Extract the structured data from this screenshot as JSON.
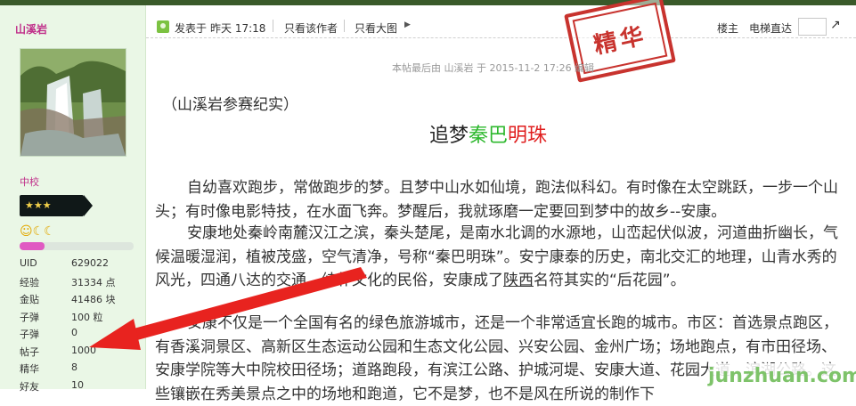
{
  "author": {
    "username": "山溪岩",
    "rank_title": "中校",
    "rank_stars": "★★★",
    "credit_progress": 0.22,
    "stats": [
      {
        "label": "UID",
        "value": "629022"
      },
      {
        "label": "经验",
        "value": "31334 点"
      },
      {
        "label": "金贴",
        "value": "41486 块"
      },
      {
        "label": "子弹",
        "value": "100 粒"
      },
      {
        "label": "子弹",
        "value": "0"
      },
      {
        "label": "帖子",
        "value": "1000"
      },
      {
        "label": "精华",
        "value": "8"
      },
      {
        "label": "好友",
        "value": "10"
      }
    ]
  },
  "post_header": {
    "posted_prefix": "发表于",
    "posted_time": "昨天 17:18",
    "only_author": "只看该作者",
    "view_large": "只看大图",
    "floor": "楼主",
    "elevator": "电梯直达"
  },
  "stamp_text": "精华",
  "last_edit": "本帖最后由 山溪岩 于 2015-11-2 17:26 编辑",
  "intro": "（山溪岩参赛纪实）",
  "title": {
    "part1": "追梦",
    "part2": "秦巴",
    "part3": "明珠"
  },
  "paragraphs": {
    "p1": "自幼喜欢跑步，常做跑步的梦。且梦中山水如仙境，跑法似科幻。有时像在太空跳跃，一步一个山头；有时像电影特技，在水面飞奔。梦醒后，我就琢磨一定要回到梦中的故乡--安康。",
    "p2_a": "安康地处秦岭南麓汉江之滨，秦头楚尾，是南水北调的水源地，山峦起伏似波，河道曲折幽长，气候温暖湿润，植被茂盛，空气清净，号称“秦巴明珠”。安宁康泰的历史，南北交汇的地理，山青水秀的风光，四通八达的交通，纯朴文化的民俗，安康成了",
    "p2_link": "陕西",
    "p2_b": "名符其实的“后花园”。",
    "p3": "安康不仅是一个全国有名的绿色旅游城市，还是一个非常适宜长跑的城市。市区：首选景点跑区，有香溪洞景区、高新区生态运动公园和生态文化公园、兴安公园、金州广场；场地跑点，有市田径场、安康学院等大中院校田径场；道路跑段，有滨江公路、护城河堤、安康大道、花园大道、滨湖公路。这些镶嵌在秀美景点之中的场地和跑道，它不是梦，也不是风在所说的制作下"
  },
  "watermark": "junzhuan.com",
  "colors": {
    "accent_pink": "#c0308a",
    "title_green": "#2eb82e",
    "title_red": "#e01e1e",
    "stamp_red": "#c8332e",
    "arrow_red": "#e8231f"
  }
}
